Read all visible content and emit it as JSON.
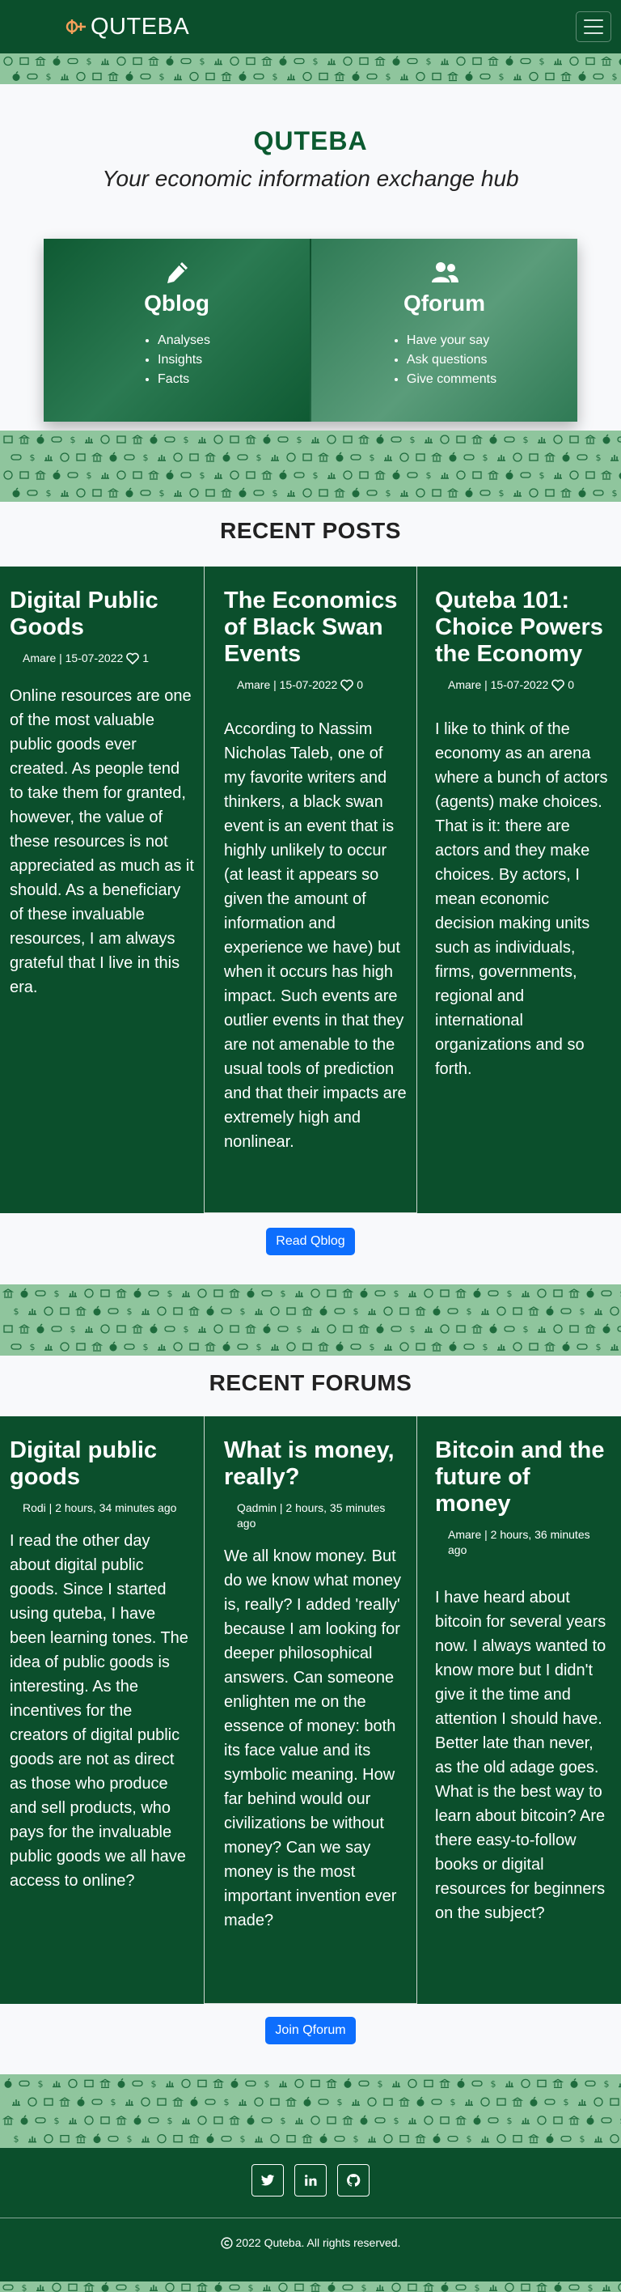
{
  "navbar": {
    "brand": "QUTEBA",
    "logo_icon": "dollar-peso-logo-icon",
    "menu_icon": "hamburger-menu-icon"
  },
  "hero": {
    "title": "QUTEBA",
    "tagline": "Your economic information exchange hub",
    "panels": [
      {
        "icon": "pencil-icon",
        "title": "Qblog",
        "items": [
          "Analyses",
          "Insights",
          "Facts"
        ]
      },
      {
        "icon": "users-icon",
        "title": "Qforum",
        "items": [
          "Have your say",
          "Ask questions",
          "Give comments"
        ]
      }
    ]
  },
  "recent_posts": {
    "heading": "RECENT POSTS",
    "posts": [
      {
        "title": "Digital Public Goods",
        "meta": "Amare | 15-07-2022",
        "likes": "1",
        "body": "Online resources are one of the most valuable public goods ever created. As people tend to take them for granted, however, the value of these resources is not appreciated as much as it should. As a beneficiary of these invaluable resources, I am always grateful that I live in this era."
      },
      {
        "title": "The Economics of Black Swan Events",
        "meta": "Amare | 15-07-2022",
        "likes": "0",
        "body": "According to Nassim Nicholas Taleb, one of my favorite writers and thinkers, a black swan event is an event that is highly unlikely to occur (at least it appears so given the amount of information and experience we have) but when it occurs has high impact. Such events are outlier events in that they are not amenable to the usual tools of prediction and that their impacts are extremely high and nonlinear."
      },
      {
        "title": "Quteba 101: Choice Powers the Economy",
        "meta": "Amare | 15-07-2022",
        "likes": "0",
        "body": "I like to think of the economy as an arena where a bunch of actors (agents) make choices. That is it: there are actors and they make choices. By actors, I mean economic decision making units such as individuals, firms, governments, regional and international organizations and so forth."
      }
    ],
    "button": "Read Qblog"
  },
  "recent_forums": {
    "heading": "RECENT FORUMS",
    "forums": [
      {
        "title": "Digital public goods",
        "meta": "Rodi | 2 hours, 34 minutes ago",
        "body": "I read the other day about digital public goods. Since I started using quteba, I have been learning tones. The idea of public goods is interesting. As the incentives for the creators of digital public goods are not as direct as those who produce and sell products, who pays for the invaluable public goods we all have access to online?"
      },
      {
        "title": "What is money, really?",
        "meta": "Qadmin | 2 hours, 35 minutes ago",
        "body": "We all know money. But do we know what money is, really? I added 'really' because I am looking for deeper philosophical answers. Can someone enlighten me on the essence of money: both its face value and its symbolic meaning. How far behind would our civilizations be without money? Can we say money is the most important invention ever made?"
      },
      {
        "title": "Bitcoin and the future of money",
        "meta": "Amare | 2 hours, 36 minutes ago",
        "body": "I have heard about bitcoin for several years now. I always wanted to know more but I didn't give it the time and attention I should have. Better late than never, as the old adage goes. What is the best way to learn about bitcoin? Are there easy-to-follow books or digital resources for beginners on the subject?"
      }
    ],
    "button": "Join Qforum"
  },
  "footer": {
    "social": [
      "twitter-icon",
      "linkedin-icon",
      "github-icon"
    ],
    "copyright": "2022 Quteba. All rights reserved."
  },
  "colors": {
    "brand_green": "#0b4f2c",
    "pattern_green": "#8fc59d",
    "accent_orange": "#f5a05a",
    "button_blue": "#0d6efd"
  }
}
